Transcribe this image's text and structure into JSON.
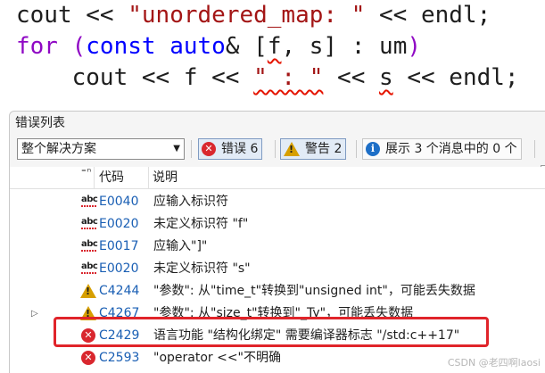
{
  "editor": {
    "line1": {
      "a": "cout ",
      "b": "<< ",
      "c": "\"unordered_map: \"",
      "d": " << endl;"
    },
    "line2": {
      "for": "for",
      "open": " (",
      "const": "const",
      "sp1": " ",
      "auto": "auto",
      "amp": "& ",
      "lb": "[",
      "f": "f",
      "mid": ", s] : ",
      "um": "um",
      "close": ")"
    },
    "line3": {
      "a": "    cout << f << ",
      "str": "\" : \"",
      "b": " << ",
      "s": "s",
      "c": " << endl;"
    }
  },
  "panel": {
    "title": "错误列表",
    "scope": "整个解决方案",
    "errors_label": "错误 6",
    "warnings_label": "警告 2",
    "messages_label": "展示 3 个消息中的 0 个"
  },
  "grid": {
    "col_code": "代码",
    "col_desc": "说明",
    "rows": [
      {
        "icon": "abc",
        "code": "E0040",
        "desc": "应输入标识符"
      },
      {
        "icon": "abc",
        "code": "E0020",
        "desc": "未定义标识符 \"f\""
      },
      {
        "icon": "abc",
        "code": "E0017",
        "desc": "应输入\"]\""
      },
      {
        "icon": "abc",
        "code": "E0020",
        "desc": "未定义标识符 \"s\""
      },
      {
        "icon": "warning",
        "code": "C4244",
        "desc": "\"参数\": 从\"time_t\"转换到\"unsigned int\"，可能丢失数据"
      },
      {
        "icon": "warning",
        "code": "C4267",
        "desc": "\"参数\": 从\"size_t\"转换到\"_Ty\"，可能丢失数据"
      },
      {
        "icon": "error",
        "code": "C2429",
        "desc": "语言功能 \"结构化绑定\" 需要编译器标志 \"/std:c++17\""
      },
      {
        "icon": "error",
        "code": "C2593",
        "desc": "\"operator <<\"不明确"
      }
    ]
  },
  "watermark": "CSDN @老四啊laosi",
  "colors": {
    "keyword": "#0000ff",
    "flow_keyword": "#8f08c4",
    "string": "#a31515",
    "error_red": "#d9272e",
    "warning_yellow": "#d79f00",
    "code_link": "#1a5fb4",
    "highlight_box": "#e0242a"
  }
}
